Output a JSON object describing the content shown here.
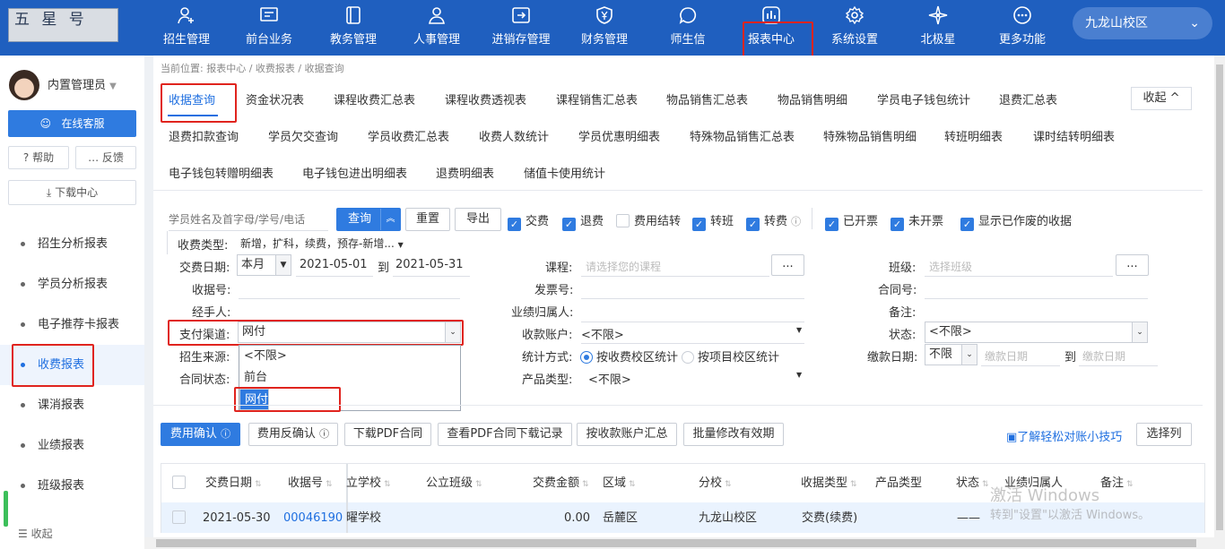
{
  "header": {
    "logo_text": "五 星 号",
    "nav": [
      {
        "label": "招生管理",
        "icon": "person-add-icon"
      },
      {
        "label": "前台业务",
        "icon": "monitor-icon"
      },
      {
        "label": "教务管理",
        "icon": "book-icon"
      },
      {
        "label": "人事管理",
        "icon": "person-icon"
      },
      {
        "label": "进销存管理",
        "icon": "export-box-icon"
      },
      {
        "label": "财务管理",
        "icon": "yen-shield-icon"
      },
      {
        "label": "师生信",
        "icon": "chat-bubble-icon"
      },
      {
        "label": "报表中心",
        "icon": "bar-report-icon"
      },
      {
        "label": "系统设置",
        "icon": "gear-icon"
      },
      {
        "label": "北极星",
        "icon": "star-icon"
      },
      {
        "label": "更多功能",
        "icon": "more-dots-icon"
      }
    ],
    "campus": "九龙山校区"
  },
  "sidebar": {
    "user": "内置管理员",
    "online_service": "在线客服",
    "help": "帮助",
    "feedback": "反馈",
    "download": "下载中心",
    "menu": [
      "招生分析报表",
      "学员分析报表",
      "电子推荐卡报表",
      "收费报表",
      "课消报表",
      "业绩报表",
      "班级报表"
    ],
    "collapse": "收起"
  },
  "breadcrumb": "当前位置:  报表中心 / 收费报表 / 收据查询",
  "tabs_row1": [
    "收据查询",
    "资金状况表",
    "课程收费汇总表",
    "课程收费透视表",
    "课程销售汇总表",
    "物品销售汇总表",
    "物品销售明细",
    "学员电子钱包统计",
    "退费汇总表"
  ],
  "tabs_row2": [
    "退费扣款查询",
    "学员欠交查询",
    "学员收费汇总表",
    "收费人数统计",
    "学员优惠明细表",
    "特殊物品销售汇总表",
    "特殊物品销售明细",
    "转班明细表",
    "课时结转明细表"
  ],
  "tabs_row3": [
    "电子钱包转赠明细表",
    "电子钱包进出明细表",
    "退费明细表",
    "储值卡使用统计"
  ],
  "collapse_btn": "收起 ^",
  "toolbar": {
    "search_placeholder": "学员姓名及首字母/学号/电话",
    "query": "查询",
    "reset": "重置",
    "export": "导出",
    "checks": [
      {
        "label": "交费",
        "checked": true
      },
      {
        "label": "退费",
        "checked": true
      },
      {
        "label": "费用结转",
        "checked": false
      },
      {
        "label": "转班",
        "checked": true
      },
      {
        "label": "转费",
        "checked": true
      },
      {
        "label": "已开票",
        "checked": true
      },
      {
        "label": "未开票",
        "checked": true
      },
      {
        "label": "显示已作废的收据",
        "checked": true
      }
    ]
  },
  "filters": {
    "fee_type_label": "收费类型:",
    "fee_type_value": "新增，扩科，续费，预存-新增...",
    "date_label": "交费日期:",
    "date_mode": "本月",
    "date_from": "2021-05-01",
    "date_to_label": "到",
    "date_to": "2021-05-31",
    "receipt_label": "收据号:",
    "handler_label": "经手人:",
    "pay_channel_label": "支付渠道:",
    "pay_channel_value": "网付",
    "source_label": "招生来源:",
    "contract_label": "合同状态:",
    "course_label": "课程:",
    "course_placeholder": "请选择您的课程",
    "invoice_label": "发票号:",
    "perf_label": "业绩归属人:",
    "account_label": "收款账户:",
    "account_value": "<不限>",
    "stat_label": "统计方式:",
    "stat_opt1": "按收费校区统计",
    "stat_opt2": "按项目校区统计",
    "product_label": "产品类型:",
    "product_value": "<不限>",
    "class_label": "班级:",
    "class_placeholder": "选择班级",
    "contract_no_label": "合同号:",
    "remark_label": "备注:",
    "status_label": "状态:",
    "status_value": "<不限>",
    "pay_date_label": "缴款日期:",
    "pay_date_mode": "不限",
    "pay_date_ph": "缴款日期",
    "pay_date_to": "到",
    "ellipsis": "..."
  },
  "pay_dropdown": [
    "<不限>",
    "前台",
    "网付"
  ],
  "actions": [
    "费用确认",
    "费用反确认",
    "下载PDF合同",
    "查看PDF合同下载记录",
    "按收款账户汇总",
    "批量修改有效期"
  ],
  "tips_link": "了解轻松对账小技巧",
  "choose_cols": "选择列",
  "table": {
    "headers": [
      "交费日期",
      "收据号",
      "立学校",
      "公立班级",
      "交费金额",
      "区域",
      "分校",
      "收据类型",
      "产品类型",
      "状态",
      "业绩归属人",
      "备注"
    ],
    "row": [
      "2021-05-30",
      "00046190",
      "曜学校",
      "",
      "0.00",
      "岳麓区",
      "九龙山校区",
      "交费(续费)",
      "",
      "——",
      "",
      ""
    ]
  },
  "watermark": {
    "line1": "激活 Windows",
    "line2": "转到\"设置\"以激活 Windows。"
  }
}
